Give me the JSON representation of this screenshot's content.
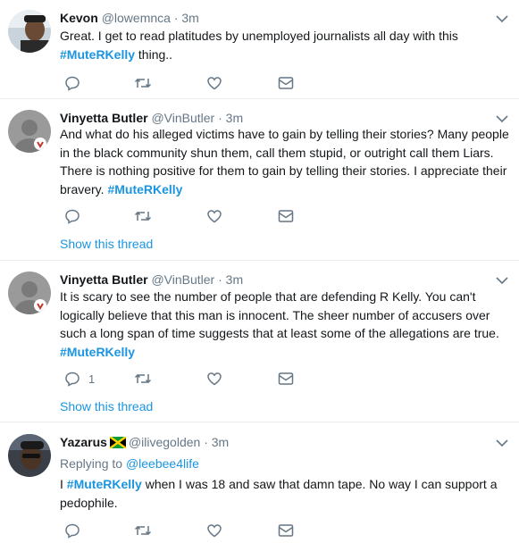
{
  "tweets": [
    {
      "name": "Kevon",
      "handle": "@lowemnca",
      "dot": "·",
      "time": "3m",
      "avatar_icon": "avatar-photo",
      "text_before": "Great. I get to read platitudes by unemployed journalists all day with this ",
      "hashtag": "#MuteRKelly",
      "text_after": " thing..",
      "reply_count": "",
      "show_thread": ""
    },
    {
      "name": "Vinyetta Butler",
      "handle": "@VinButler",
      "dot": "·",
      "time": "3m",
      "avatar_icon": "default-avatar-with-badge",
      "text_before": "And what do his alleged victims have to gain by telling their stories? Many people in the black community shun them, call them stupid, or outright call them Liars. There is nothing positive for them to gain by telling their stories. I appreciate their bravery.  ",
      "hashtag": "#MuteRKelly",
      "text_after": "",
      "reply_count": "",
      "show_thread": "Show this thread"
    },
    {
      "name": "Vinyetta Butler",
      "handle": "@VinButler",
      "dot": "·",
      "time": "3m",
      "avatar_icon": "default-avatar-with-badge",
      "text_before": "It is scary to see the number of people that are defending R Kelly. You can't logically believe that this man is innocent. The sheer number of accusers over such a long span of time suggests that at least some of the allegations are true. ",
      "hashtag": "#MuteRKelly",
      "text_after": "",
      "reply_count": "1",
      "show_thread": "Show this thread"
    },
    {
      "name": "Yazarus",
      "handle": "@ilivegolden",
      "dot": "·",
      "time": "3m",
      "avatar_icon": "avatar-photo",
      "flag_icon": "jamaica-flag-icon",
      "replying_label": "Replying to",
      "replying_handle": "@leebee4life",
      "text_before": "I ",
      "hashtag": "#MuteRKelly",
      "text_after": " when I was 18 and saw that damn tape. No way I can support a pedophile.",
      "reply_count": "",
      "show_thread": ""
    }
  ],
  "colors": {
    "link": "#1b95e0",
    "secondary_text": "#657786",
    "divider": "#e6ecf0"
  }
}
